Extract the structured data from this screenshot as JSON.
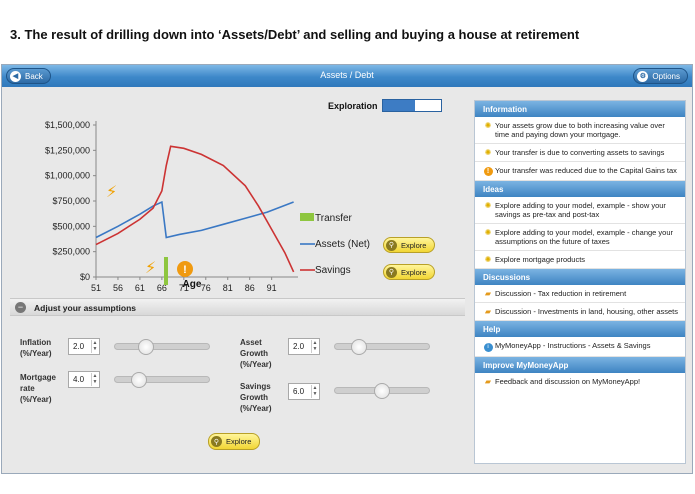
{
  "caption": "3.   The result of drilling down into ‘Assets/Debt’ and selling and buying a house at retirement",
  "topbar": {
    "back_label": "Back",
    "title": "Assets / Debt",
    "options_label": "Options"
  },
  "exploration": {
    "label": "Exploration",
    "level": 0.55
  },
  "chart_data": {
    "type": "line",
    "xlabel": "Age",
    "ylabel": "",
    "x_ticks": [
      51,
      56,
      61,
      66,
      71,
      76,
      81,
      86,
      91
    ],
    "y_ticks": [
      "$0",
      "$250,000",
      "$500,000",
      "$750,000",
      "$1,000,000",
      "$1,250,000",
      "$1,500,000"
    ],
    "xlim": [
      51,
      97
    ],
    "ylim": [
      0,
      1500000
    ],
    "series": [
      {
        "name": "Assets (Net)",
        "color": "#3a78c4",
        "x": [
          51,
          56,
          61,
          64,
          66,
          67,
          70,
          75,
          80,
          85,
          90,
          96
        ],
        "y": [
          390000,
          500000,
          620000,
          700000,
          740000,
          390000,
          420000,
          460000,
          520000,
          580000,
          640000,
          740000
        ]
      },
      {
        "name": "Savings",
        "color": "#cc3333",
        "x": [
          51,
          56,
          61,
          64,
          66,
          67,
          68,
          71,
          75,
          80,
          85,
          88,
          91,
          94,
          96
        ],
        "y": [
          320000,
          430000,
          570000,
          680000,
          850000,
          1100000,
          1290000,
          1270000,
          1210000,
          1100000,
          900000,
          700000,
          470000,
          240000,
          50000
        ]
      },
      {
        "name": "Transfer",
        "color": "#8ec63f",
        "x": [
          66
        ],
        "y": [
          200000
        ]
      }
    ],
    "legend_placement": "right"
  },
  "legend": {
    "transfer": "Transfer",
    "assets": "Assets (Net)",
    "savings": "Savings"
  },
  "explore_label": "Explore",
  "assumptions": {
    "header": "Adjust your assumptions",
    "inflation": {
      "label": "Inflation (%/Year)",
      "value": "2.0",
      "level": 0.3
    },
    "mortgage": {
      "label": "Mortgage rate (%/Year)",
      "value": "4.0",
      "level": 0.2
    },
    "asset_growth": {
      "label": "Asset Growth (%/Year)",
      "value": "2.0",
      "level": 0.2
    },
    "savings_growth": {
      "label": "Savings Growth (%/Year)",
      "value": "6.0",
      "level": 0.5
    }
  },
  "panel": {
    "information": {
      "title": "Information",
      "items": [
        "Your assets grow due to both increasing value over time and paying down your mortgage.",
        "Your transfer is due to converting assets to savings",
        "Your transfer was reduced due to the Capital Gains tax"
      ]
    },
    "ideas": {
      "title": "Ideas",
      "items": [
        "Explore adding to your model, example - show your savings as pre-tax and post-tax",
        "Explore adding to your model, example - change your assumptions on the future of taxes",
        "Explore mortgage products"
      ]
    },
    "discussions": {
      "title": "Discussions",
      "items": [
        "Discussion - Tax reduction in retirement",
        "Discussion - Investments in land, housing, other assets"
      ]
    },
    "help": {
      "title": "Help",
      "items": [
        "MyMoneyApp - Instructions - Assets & Savings"
      ]
    },
    "improve": {
      "title": "Improve MyMoneyApp",
      "items": [
        "Feedback and discussion on MyMoneyApp!"
      ]
    }
  }
}
